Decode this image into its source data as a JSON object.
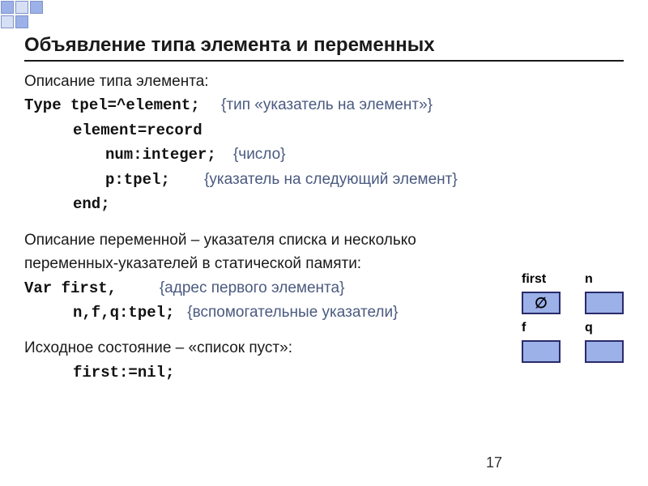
{
  "title": "Объявление типа элемента и переменных",
  "desc_type": "Описание типа элемента:",
  "code": {
    "l1a": "Type tpel=^element;",
    "l1c": "{тип «указатель на элемент»}",
    "l2": "element=record",
    "l3a": "num:integer;",
    "l3c": "{число}",
    "l4a": "p:tpel;",
    "l4c": "{указатель на следующий элемент}",
    "l5": "end;"
  },
  "desc_var": "Описание переменной – указателя  списка  и несколько переменных-указателей в статической памяти:",
  "var": {
    "l1a": "Var first,",
    "l1c": "{адрес первого элемента}",
    "l2a": "n,f,q:tpel;",
    "l2c": "{вспомогательные указатели}"
  },
  "desc_init": "Исходное состояние – «список пуст»:",
  "init": "first:=nil;",
  "boxes": {
    "first": "first",
    "n": "n",
    "f": "f",
    "q": "q",
    "empty": "∅"
  },
  "page": "17"
}
